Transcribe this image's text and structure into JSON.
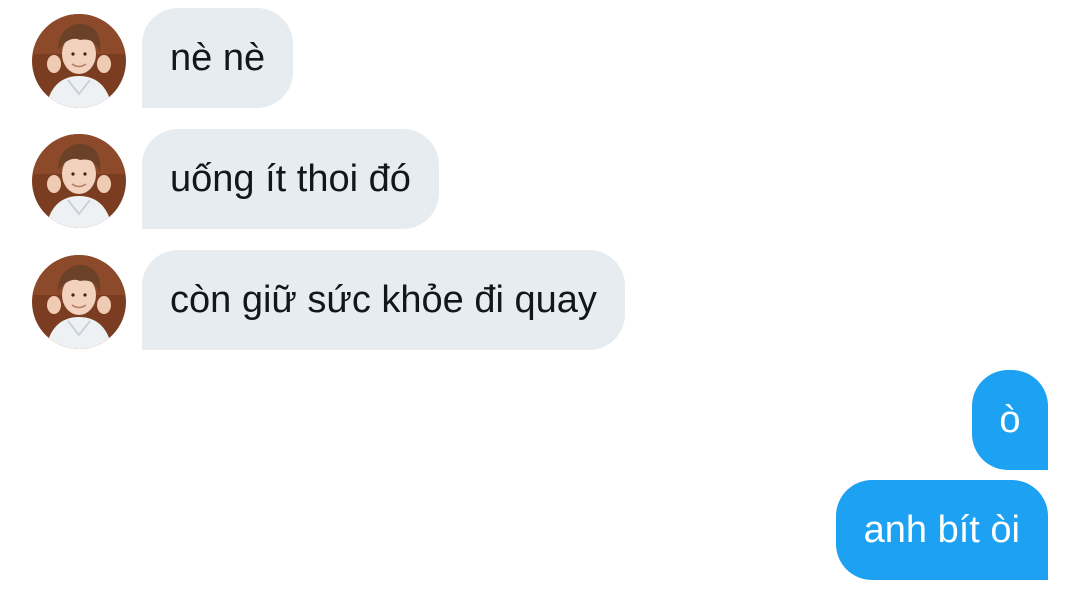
{
  "conversation": {
    "received": [
      {
        "text": "nè nè",
        "avatar": "user-avatar"
      },
      {
        "text": "uống ít thoi đó",
        "avatar": "user-avatar"
      },
      {
        "text": "còn giữ sức khỏe đi quay",
        "avatar": "user-avatar"
      }
    ],
    "sent": [
      {
        "text": "ò"
      },
      {
        "text": "anh bít òi"
      }
    ]
  },
  "colors": {
    "received_bubble": "#e6ecf0",
    "sent_bubble": "#1da1f2",
    "received_text": "#14171a",
    "sent_text": "#ffffff"
  }
}
